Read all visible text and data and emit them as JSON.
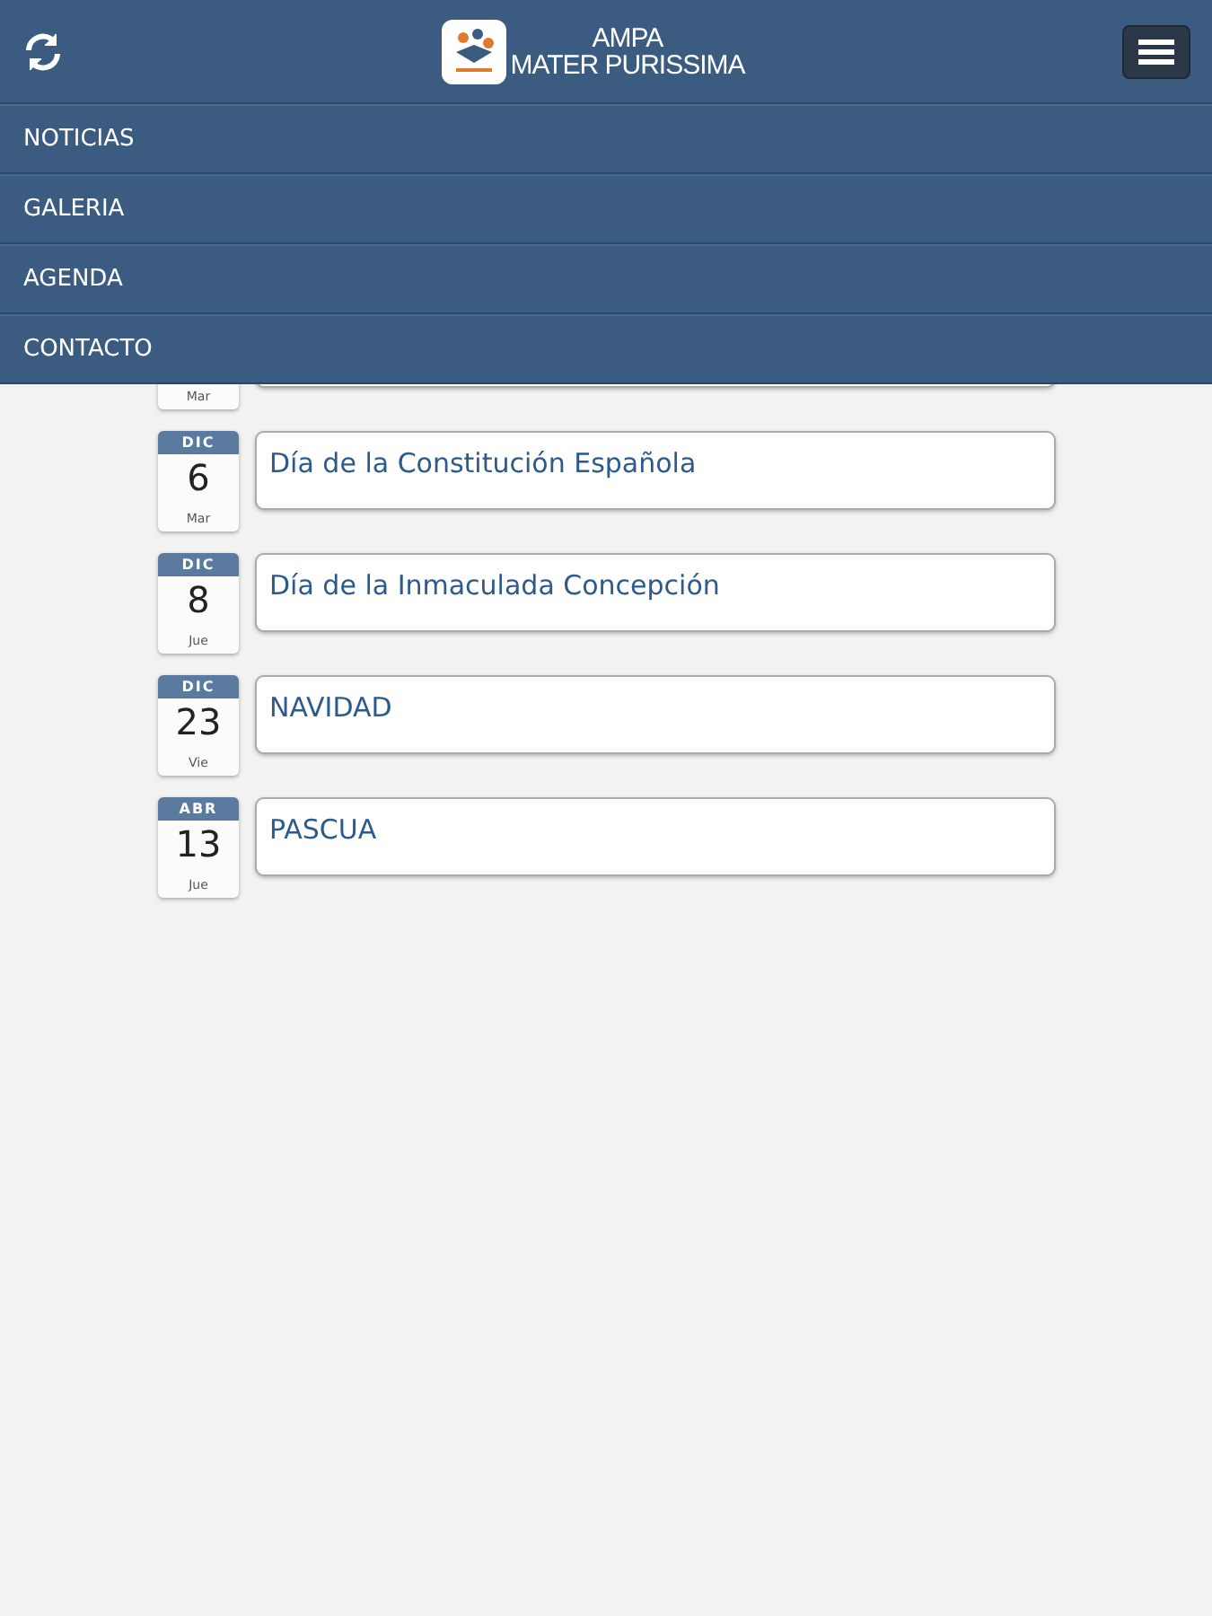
{
  "header": {
    "title_line_1": "AMPA",
    "title_line_2": "MATER PURISSIMA"
  },
  "menu": [
    {
      "label": "NOTICIAS"
    },
    {
      "label": "GALERIA"
    },
    {
      "label": "AGENDA"
    },
    {
      "label": "CONTACTO"
    }
  ],
  "events": [
    {
      "weekday": "Mar"
    },
    {
      "month": "DIC",
      "day": "6",
      "weekday": "Mar",
      "title": "Día de la Constitución Española"
    },
    {
      "month": "DIC",
      "day": "8",
      "weekday": "Jue",
      "title": "Día de la Inmaculada Concepción"
    },
    {
      "month": "DIC",
      "day": "23",
      "weekday": "Vie",
      "title": "NAVIDAD"
    },
    {
      "month": "ABR",
      "day": "13",
      "weekday": "Jue",
      "title": "PASCUA"
    }
  ]
}
